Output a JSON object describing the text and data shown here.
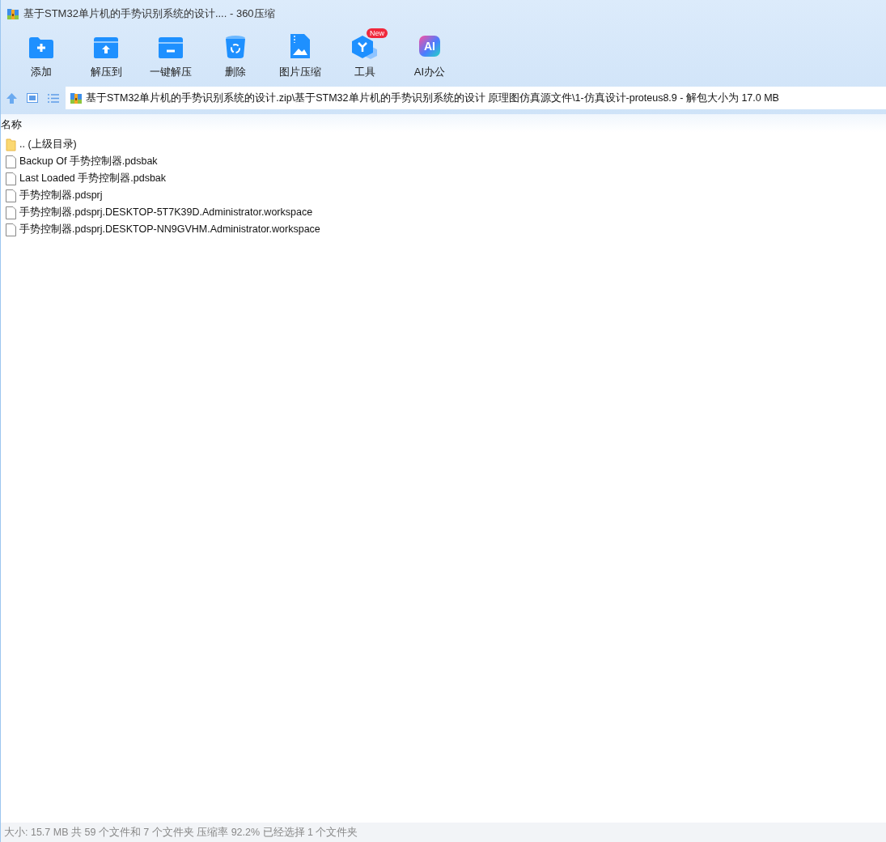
{
  "window": {
    "title": "基于STM32单片机的手势识别系统的设计.... - 360压缩"
  },
  "toolbar": [
    {
      "label": "添加"
    },
    {
      "label": "解压到"
    },
    {
      "label": "一键解压"
    },
    {
      "label": "删除"
    },
    {
      "label": "图片压缩"
    },
    {
      "label": "工具",
      "badge": "New"
    },
    {
      "label": "AI办公",
      "icon_text": "AI"
    }
  ],
  "address": {
    "path": "基于STM32单片机的手势识别系统的设计.zip\\基于STM32单片机的手势识别系统的设计 原理图仿真源文件\\1-仿真设计-proteus8.9 - 解包大小为 17.0 MB"
  },
  "table": {
    "columns": [
      "名称"
    ],
    "rows": [
      {
        "kind": "folder",
        "name": ".. (上级目录)"
      },
      {
        "kind": "file",
        "name": "Backup Of 手势控制器.pdsbak"
      },
      {
        "kind": "file",
        "name": "Last Loaded 手势控制器.pdsbak"
      },
      {
        "kind": "file",
        "name": "手势控制器.pdsprj"
      },
      {
        "kind": "file",
        "name": "手势控制器.pdsprj.DESKTOP-5T7K39D.Administrator.workspace"
      },
      {
        "kind": "file",
        "name": "手势控制器.pdsprj.DESKTOP-NN9GVHM.Administrator.workspace"
      }
    ]
  },
  "status_bar": "大小: 15.7 MB 共 59 个文件和 7 个文件夹 压缩率 92.2% 已经选择 1 个文件夹"
}
